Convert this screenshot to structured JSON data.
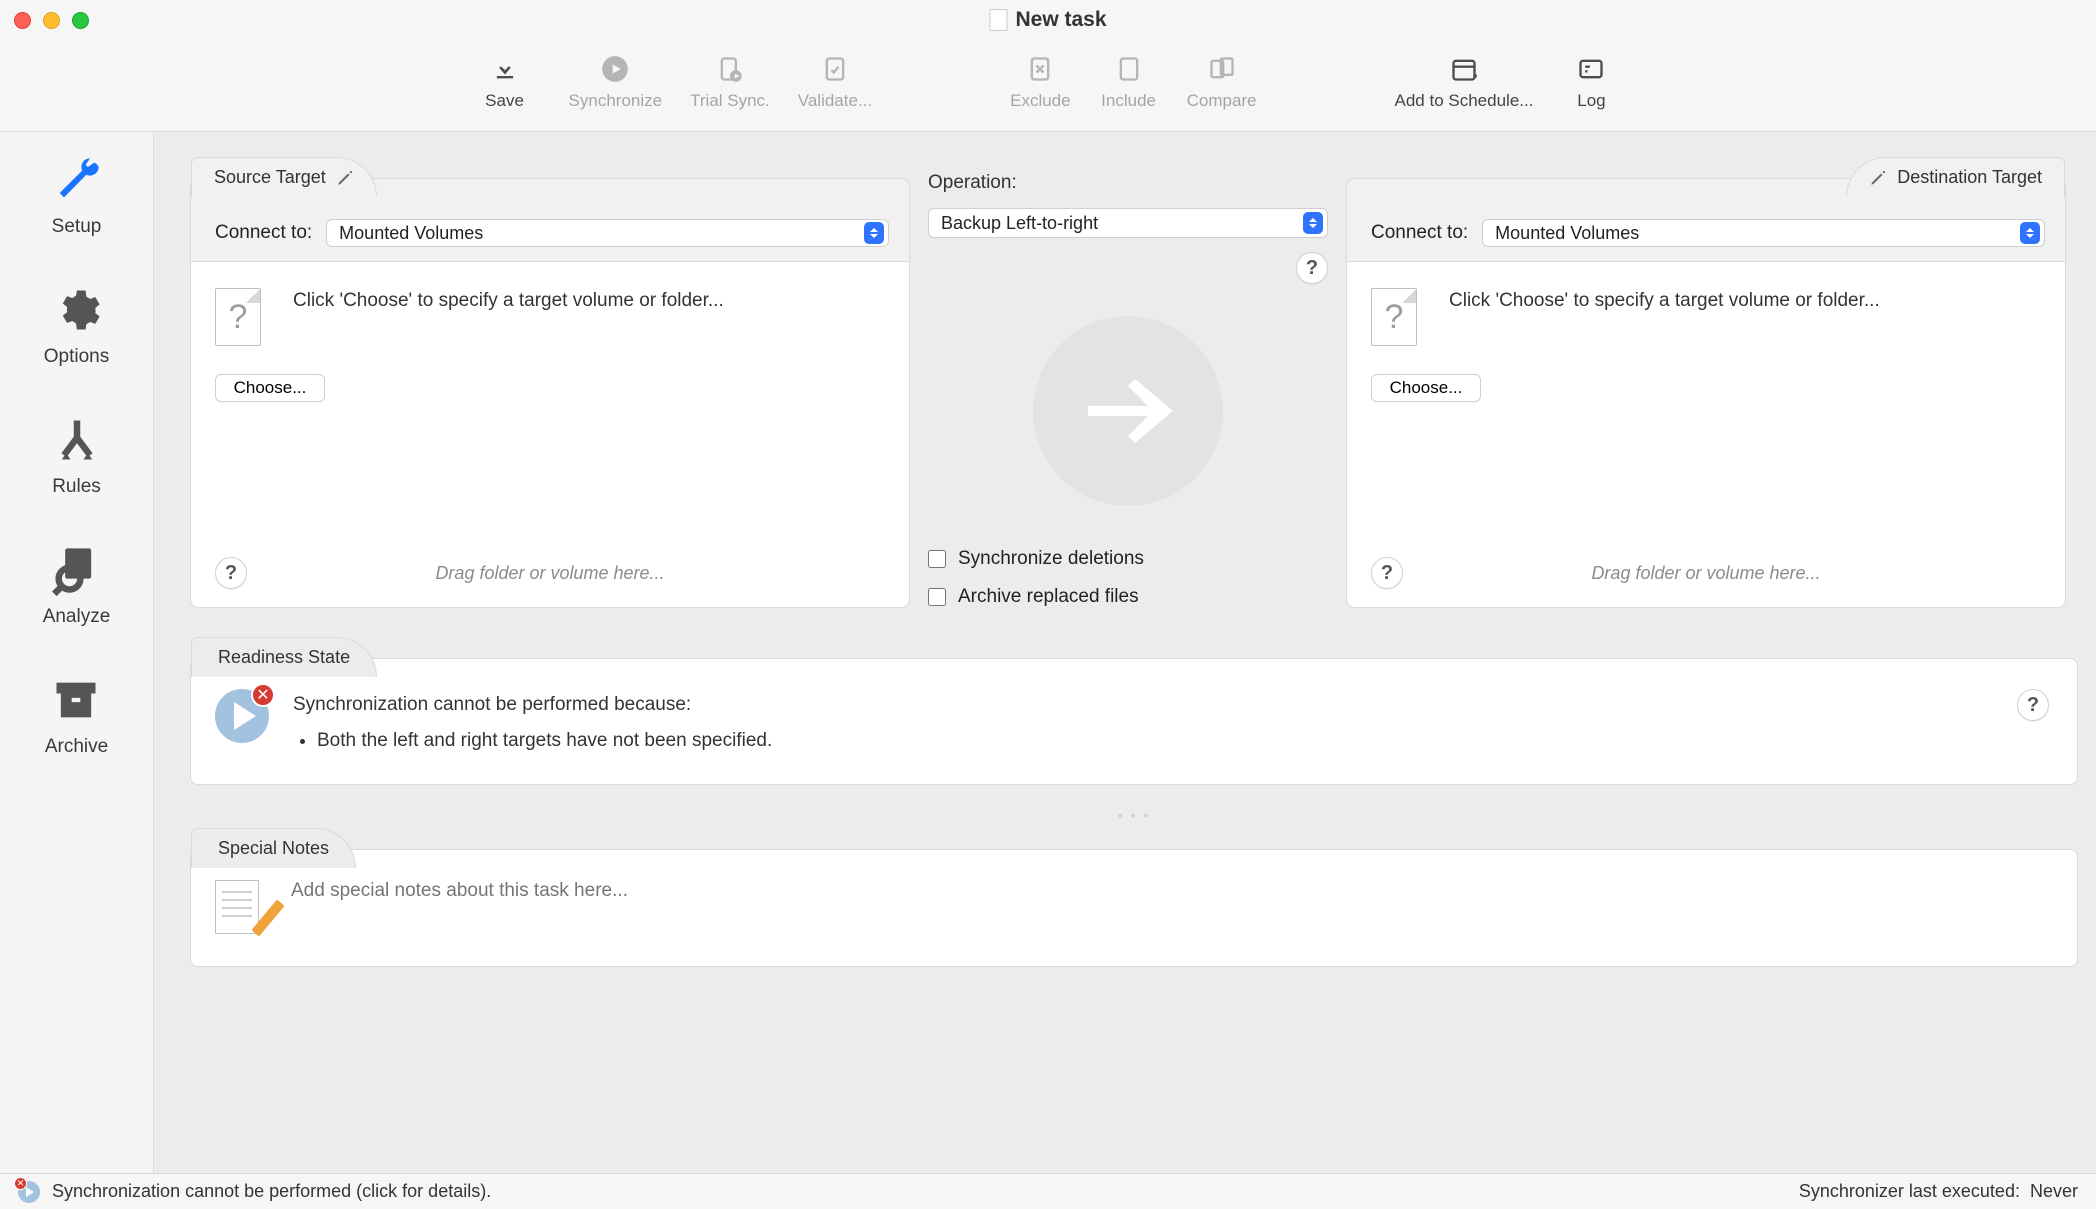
{
  "window": {
    "title": "New task"
  },
  "toolbar": {
    "save": "Save",
    "synchronize": "Synchronize",
    "trial_sync": "Trial Sync.",
    "validate": "Validate...",
    "exclude": "Exclude",
    "include": "Include",
    "compare": "Compare",
    "add_to_schedule": "Add to Schedule...",
    "log": "Log"
  },
  "sidebar": {
    "setup": {
      "label": "Setup"
    },
    "options": {
      "label": "Options"
    },
    "rules": {
      "label": "Rules"
    },
    "analyze": {
      "label": "Analyze"
    },
    "archive": {
      "label": "Archive"
    }
  },
  "panels": {
    "source": {
      "title": "Source Target",
      "connect_label": "Connect to:",
      "connect_value": "Mounted Volumes",
      "hint": "Click 'Choose' to specify a target volume or folder...",
      "choose": "Choose...",
      "drag_hint": "Drag folder or volume here..."
    },
    "destination": {
      "title": "Destination Target",
      "connect_label": "Connect to:",
      "connect_value": "Mounted Volumes",
      "hint": "Click 'Choose' to specify a target volume or folder...",
      "choose": "Choose...",
      "drag_hint": "Drag folder or volume here..."
    },
    "operation": {
      "label": "Operation:",
      "value": "Backup Left-to-right",
      "sync_deletions": "Synchronize deletions",
      "archive_replaced": "Archive replaced files"
    },
    "readiness": {
      "title": "Readiness State",
      "heading": "Synchronization cannot be performed because:",
      "bullet": "Both the left and right targets have not been specified."
    },
    "notes": {
      "title": "Special Notes",
      "placeholder": "Add special notes about this task here..."
    }
  },
  "status": {
    "left": "Synchronization cannot be performed (click for details).",
    "right_label": "Synchronizer last executed:",
    "right_value": "Never"
  }
}
